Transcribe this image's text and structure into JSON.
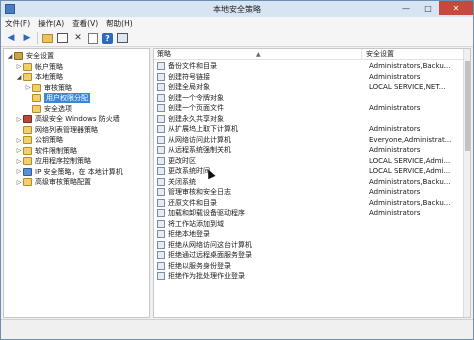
{
  "window": {
    "title": "本地安全策略"
  },
  "menu": [
    "文件(F)",
    "操作(A)",
    "查看(V)",
    "帮助(H)"
  ],
  "tree": [
    {
      "label": "安全设置",
      "level": 0,
      "expander": "◢",
      "icon": "shield",
      "selected": false
    },
    {
      "label": "帐户策略",
      "level": 1,
      "expander": "▷",
      "icon": "folder",
      "selected": false
    },
    {
      "label": "本地策略",
      "level": 1,
      "expander": "◢",
      "icon": "folder",
      "selected": false
    },
    {
      "label": "审核策略",
      "level": 2,
      "expander": "▷",
      "icon": "folder",
      "selected": false
    },
    {
      "label": "用户权限分配",
      "level": 2,
      "expander": "",
      "icon": "folder",
      "selected": true
    },
    {
      "label": "安全选项",
      "level": 2,
      "expander": "",
      "icon": "folder",
      "selected": false
    },
    {
      "label": "高级安全 Windows 防火墙",
      "level": 1,
      "expander": "▷",
      "icon": "fw",
      "selected": false
    },
    {
      "label": "网络列表管理器策略",
      "level": 1,
      "expander": "",
      "icon": "folder",
      "selected": false
    },
    {
      "label": "公钥策略",
      "level": 1,
      "expander": "▷",
      "icon": "folder",
      "selected": false
    },
    {
      "label": "软件限制策略",
      "level": 1,
      "expander": "▷",
      "icon": "folder",
      "selected": false
    },
    {
      "label": "应用程序控制策略",
      "level": 1,
      "expander": "▷",
      "icon": "folder",
      "selected": false
    },
    {
      "label": "IP 安全策略，在 本地计算机",
      "level": 1,
      "expander": "▷",
      "icon": "pc",
      "selected": false
    },
    {
      "label": "高级审核策略配置",
      "level": 1,
      "expander": "▷",
      "icon": "folder",
      "selected": false
    }
  ],
  "list": {
    "columns": [
      "策略",
      "安全设置"
    ],
    "rows": [
      {
        "name": "备份文件和目录",
        "value": "Administrators,Backu..."
      },
      {
        "name": "创建符号链接",
        "value": "Administrators"
      },
      {
        "name": "创建全局对象",
        "value": "LOCAL SERVICE,NET..."
      },
      {
        "name": "创建一个令牌对象",
        "value": ""
      },
      {
        "name": "创建一个页面文件",
        "value": "Administrators"
      },
      {
        "name": "创建永久共享对象",
        "value": ""
      },
      {
        "name": "从扩展坞上取下计算机",
        "value": "Administrators"
      },
      {
        "name": "从网络访问此计算机",
        "value": "Everyone,Administrat..."
      },
      {
        "name": "从远程系统强制关机",
        "value": "Administrators"
      },
      {
        "name": "更改时区",
        "value": "LOCAL SERVICE,Admi..."
      },
      {
        "name": "更改系统时间",
        "value": "LOCAL SERVICE,Admi..."
      },
      {
        "name": "关闭系统",
        "value": "Administrators,Backu..."
      },
      {
        "name": "管理审核和安全日志",
        "value": "Administrators"
      },
      {
        "name": "还原文件和目录",
        "value": "Administrators,Backu..."
      },
      {
        "name": "加载和卸载设备驱动程序",
        "value": "Administrators"
      },
      {
        "name": "将工作站添加到域",
        "value": ""
      },
      {
        "name": "拒绝本地登录",
        "value": ""
      },
      {
        "name": "拒绝从网络访问这台计算机",
        "value": ""
      },
      {
        "name": "拒绝通过远程桌面服务登录",
        "value": ""
      },
      {
        "name": "拒绝以服务身份登录",
        "value": ""
      },
      {
        "name": "拒绝作为批处理作业登录",
        "value": ""
      }
    ]
  }
}
